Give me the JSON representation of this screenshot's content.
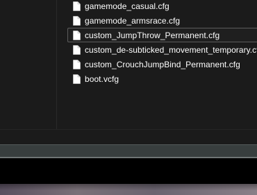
{
  "file_list": {
    "items": [
      {
        "name": "gamemode_casual.cfg",
        "icon": "document-icon",
        "focused": false
      },
      {
        "name": "gamemode_armsrace.cfg",
        "icon": "document-icon",
        "focused": false
      },
      {
        "name": "custom_JumpThrow_Permanent.cfg",
        "icon": "document-icon",
        "focused": true
      },
      {
        "name": "custom_de-subticked_movement_temporary.cfg",
        "icon": "document-icon",
        "focused": false
      },
      {
        "name": "custom_CrouchJumpBind_Permanent.cfg",
        "icon": "document-icon",
        "focused": false
      },
      {
        "name": "boot.vcfg",
        "icon": "document-icon",
        "focused": false
      }
    ]
  },
  "colors": {
    "window_background": "#1b1b1b",
    "text": "#ffffff",
    "focus_border": "#5c5c5c",
    "frame": "#383e3e"
  }
}
